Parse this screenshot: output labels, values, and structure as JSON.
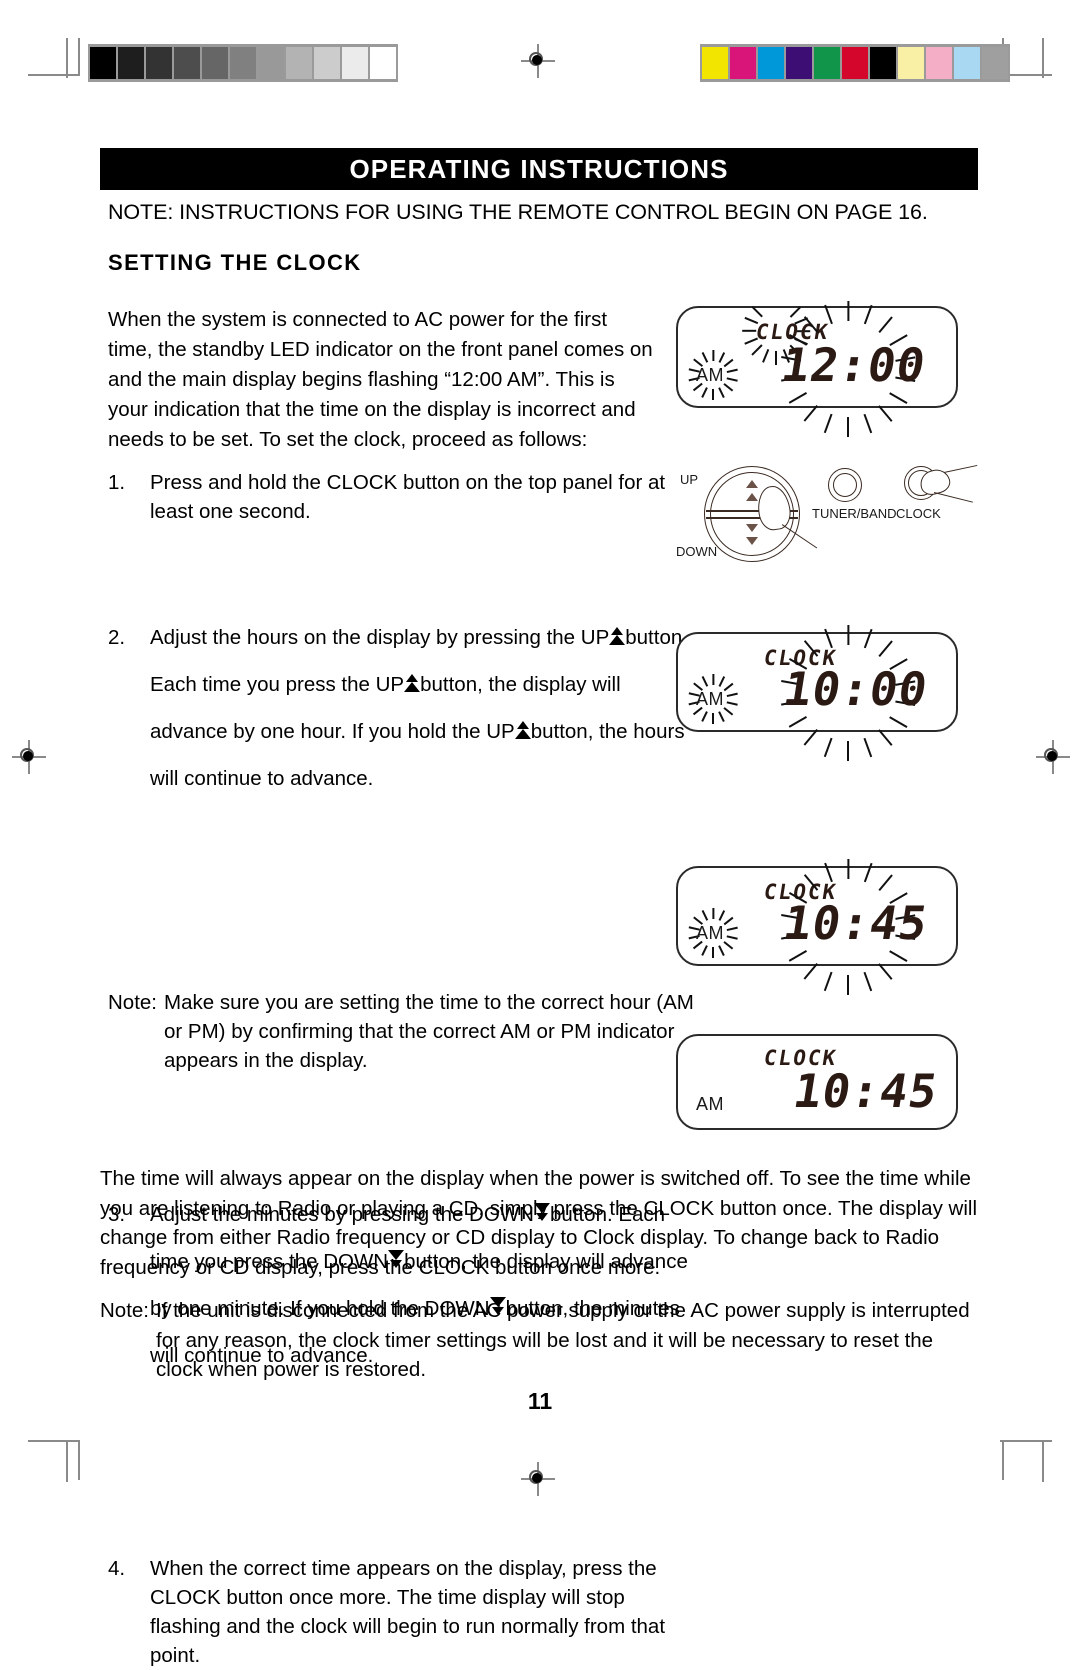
{
  "document": {
    "page_number": "11",
    "header_title": "OPERATING INSTRUCTIONS",
    "note_line": "NOTE: INSTRUCTIONS FOR  USING THE REMOTE CONTROL  BEGIN ON PAGE 16.",
    "section_heading": "SETTING THE CLOCK"
  },
  "intro": {
    "paragraph": "When the system is connected to AC power for the first time, the standby LED indicator on the front panel comes on and the main display begins flashing “12:00 AM”.  This is your indication that the time on the display is incorrect and needs to be set.  To set the clock, proceed as follows:"
  },
  "steps": {
    "one": {
      "number": "1.",
      "text": "Press and hold the CLOCK button on the top panel for at least one second."
    },
    "two": {
      "number": "2.",
      "part_a": "Adjust the hours on the display by pressing the UP",
      "part_b": "button.  Each time you press the UP",
      "part_c": "button, the display will advance by one hour.  If you hold the UP",
      "part_d": "button, the hours will continue to advance."
    },
    "note_am_pm": {
      "label": "Note:",
      "text": "Make sure you are setting the time to the correct hour (AM or PM) by confirming that the correct AM or PM indicator appears in the display."
    },
    "three": {
      "number": "3.",
      "part_a": "Adjust the minutes by pressing the DOWN",
      "part_b": "button.  Each time you press the DOWN",
      "part_c": "button, the display will advance by one minute. If you hold the DOWN",
      "part_d": "button, the minutes will continue to advance."
    },
    "four": {
      "number": "4.",
      "text": "When the correct time appears on the display, press the CLOCK button once more.  The time display will stop flashing and the clock will begin to run normally from that point."
    }
  },
  "closing": {
    "paragraph": "The time will always appear on the display when the power is switched off. To see the time while you are listening to Radio or playing a CD, simply press the CLOCK button once.  The display will change from either Radio frequency or CD display to Clock display. To change back to Radio frequency or CD display, press the CLOCK button once more.",
    "note": {
      "label": "Note:",
      "text": "If the unit is disconnected from the AC power supply or the AC power supply is interrupted for any reason, the clock timer settings will be lost and it will be necessary to reset the clock when power is restored."
    }
  },
  "displays": [
    {
      "id": "display-1200-am-flashing",
      "clock_label": "CLOCK",
      "am_label": "AM",
      "time": "12:00",
      "clock_flashing": true,
      "am_flashing": true,
      "time_flashing": true
    },
    {
      "id": "display-1000-am-flashing",
      "clock_label": "CLOCK",
      "am_label": "AM",
      "time": "10:00",
      "clock_flashing": false,
      "am_flashing": true,
      "time_flashing": true
    },
    {
      "id": "display-1045-am-flashing",
      "clock_label": "CLOCK",
      "am_label": "AM",
      "time": "10:45",
      "clock_flashing": false,
      "am_flashing": true,
      "time_flashing": true
    },
    {
      "id": "display-1045-am-steady",
      "clock_label": "CLOCK",
      "am_label": "AM",
      "time": "10:45",
      "clock_flashing": false,
      "am_flashing": false,
      "time_flashing": false
    }
  ],
  "control_panel": {
    "up_label": "UP",
    "down_label": "DOWN",
    "tuner_band_label": "TUNER/BAND",
    "clock_label": "CLOCK"
  },
  "calibration": {
    "grayscale_swatches": [
      "#000000",
      "#1e1e1e",
      "#333333",
      "#4d4d4d",
      "#666666",
      "#808080",
      "#999999",
      "#b3b3b3",
      "#cccccc",
      "#ebebeb",
      "#ffffff"
    ],
    "color_swatches": [
      "#f2e500",
      "#da1579",
      "#0098d8",
      "#3d0e73",
      "#11954a",
      "#d5062b",
      "#000000",
      "#faf0a5",
      "#f4aec6",
      "#a9d8f2",
      "#9f9f9f"
    ]
  }
}
